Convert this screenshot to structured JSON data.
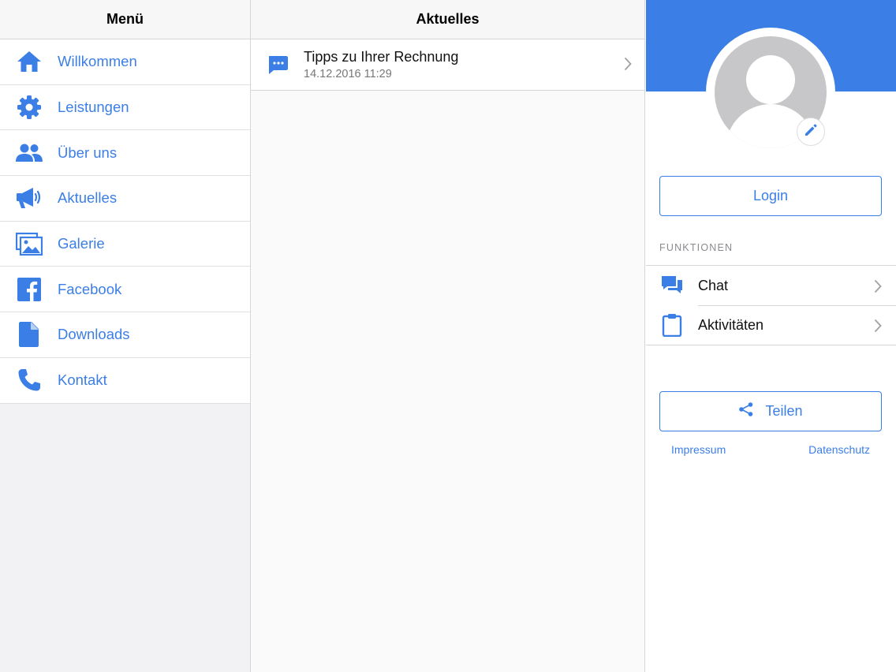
{
  "menu": {
    "title": "Menü",
    "items": [
      {
        "label": "Willkommen",
        "icon": "home-icon"
      },
      {
        "label": "Leistungen",
        "icon": "gear-icon"
      },
      {
        "label": "Über uns",
        "icon": "people-icon"
      },
      {
        "label": "Aktuelles",
        "icon": "megaphone-icon"
      },
      {
        "label": "Galerie",
        "icon": "gallery-icon"
      },
      {
        "label": "Facebook",
        "icon": "facebook-icon"
      },
      {
        "label": "Downloads",
        "icon": "document-icon"
      },
      {
        "label": "Kontakt",
        "icon": "phone-icon"
      }
    ]
  },
  "news": {
    "title": "Aktuelles",
    "items": [
      {
        "title": "Tipps zu Ihrer Rechnung",
        "date": "14.12.2016 11:29",
        "icon": "message-icon"
      }
    ]
  },
  "profile": {
    "login_label": "Login",
    "section_label": "FUNKTIONEN",
    "functions": [
      {
        "label": "Chat",
        "icon": "chat-icon"
      },
      {
        "label": "Aktivitäten",
        "icon": "clipboard-icon"
      }
    ],
    "share_label": "Teilen",
    "impressum_label": "Impressum",
    "datenschutz_label": "Datenschutz"
  },
  "colors": {
    "accent": "#3b7ee6",
    "background": "#f2f2f4",
    "divider": "#d6d6da"
  }
}
